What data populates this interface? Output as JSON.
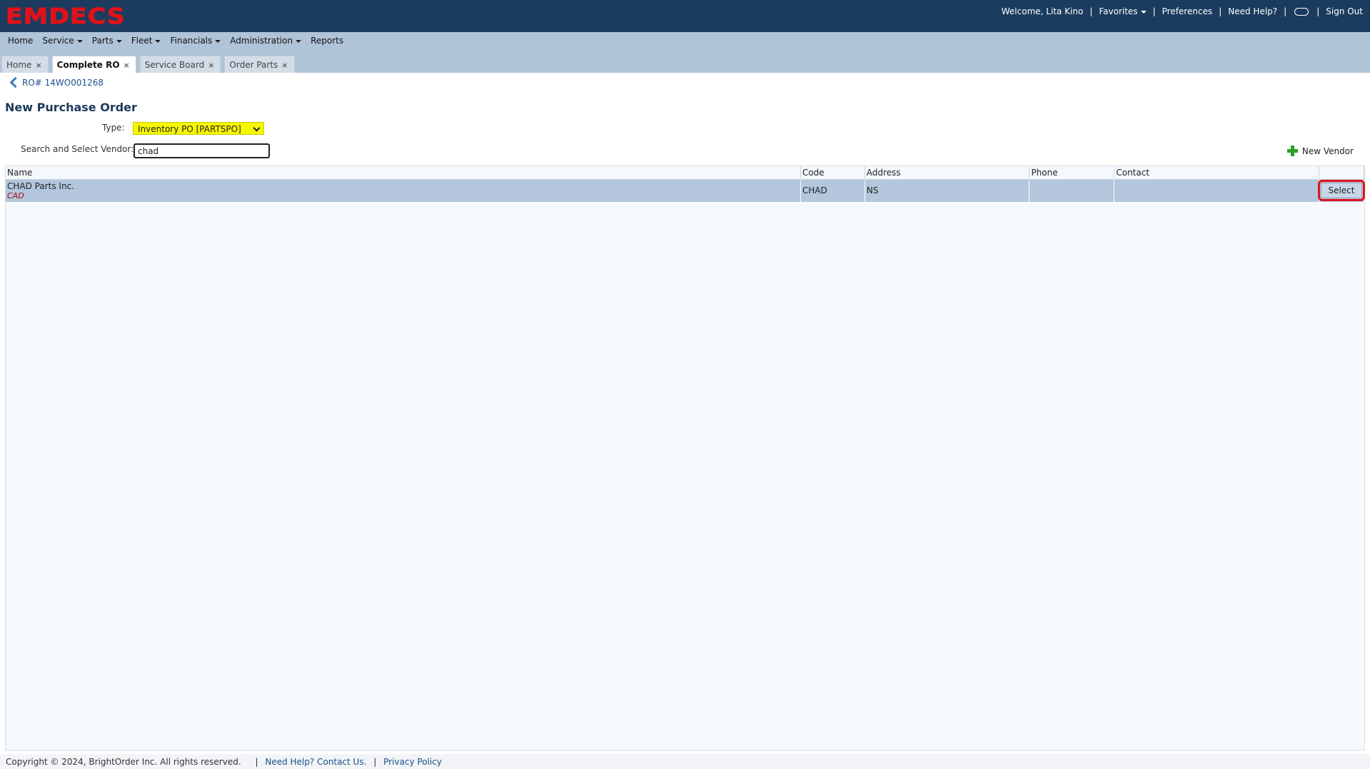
{
  "header": {
    "logo": "EMDECS",
    "welcome": "Welcome, Lita Kino",
    "favorites": "Favorites",
    "preferences": "Preferences",
    "need_help": "Need Help?",
    "sign_out": "Sign Out",
    "separator": "|"
  },
  "menu": [
    {
      "label": "Home",
      "dropdown": false
    },
    {
      "label": "Service",
      "dropdown": true
    },
    {
      "label": "Parts",
      "dropdown": true
    },
    {
      "label": "Fleet",
      "dropdown": true
    },
    {
      "label": "Financials",
      "dropdown": true
    },
    {
      "label": "Administration",
      "dropdown": true
    },
    {
      "label": "Reports",
      "dropdown": false
    }
  ],
  "tabs": [
    {
      "label": "Home",
      "active": false
    },
    {
      "label": "Complete RO",
      "active": true
    },
    {
      "label": "Service Board",
      "active": false
    },
    {
      "label": "Order Parts",
      "active": false
    }
  ],
  "tab_close": "×",
  "breadcrumb": {
    "back_label": "RO# 14WO001268"
  },
  "form": {
    "title": "New Purchase Order",
    "type_label": "Type:",
    "type_value": "Inventory PO [PARTSPO]",
    "vendor_label": "Search and Select Vendor:",
    "vendor_value": "chad",
    "new_vendor": "New Vendor"
  },
  "table": {
    "columns": [
      "Name",
      "Code",
      "Address",
      "Phone",
      "Contact",
      ""
    ],
    "rows": [
      {
        "name": "CHAD Parts Inc.",
        "currency": "CAD",
        "code": "CHAD",
        "address": "NS",
        "phone": "",
        "contact": "",
        "action": "Select"
      }
    ]
  },
  "footer": {
    "copyright": "Copyright © 2024, BrightOrder Inc. All rights reserved.",
    "help_link": "Need Help? Contact Us.",
    "privacy_link": "Privacy Policy",
    "separator": "|"
  },
  "colors": {
    "header_bg": "#1b3c5e",
    "logo": "#e0121b",
    "menubar_bg": "#b0c4d8",
    "row_selected": "#b3c6dc",
    "type_select_bg": "#f7f700",
    "highlight": "#e0121b"
  }
}
